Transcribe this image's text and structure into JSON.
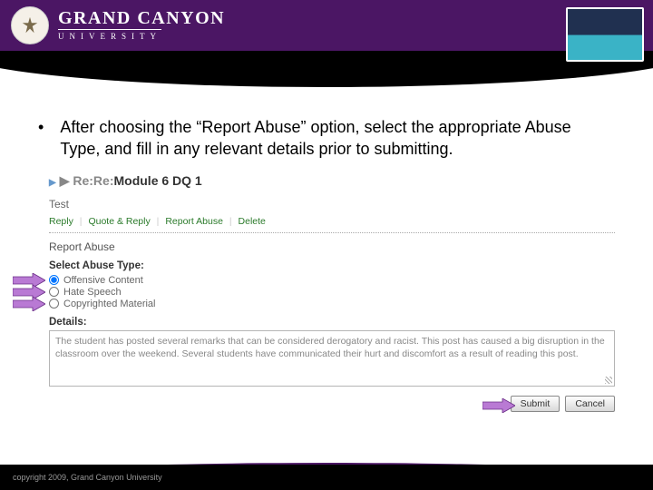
{
  "header": {
    "university_name_top": "GRAND CANYON",
    "university_name_bot": "UNIVERSITY"
  },
  "bullet_text": "After choosing the “Report Abuse” option, select the appropriate Abuse Type, and fill in any relevant details prior to submitting.",
  "screenshot": {
    "thread_prefix": "▶ Re:Re:",
    "thread_title": "Module 6 DQ 1",
    "test_label": "Test",
    "actions": {
      "reply": "Reply",
      "quote": "Quote & Reply",
      "report": "Report Abuse",
      "delete": "Delete"
    },
    "report_abuse_heading": "Report Abuse",
    "select_abuse_type": "Select Abuse Type:",
    "radios": {
      "offensive": "Offensive Content",
      "hate": "Hate Speech",
      "copyright": "Copyrighted Material"
    },
    "details_label": "Details:",
    "details_text": "The student has posted several remarks that can be considered derogatory and racist. This post has caused a big disruption in the classroom over the weekend. Several students have communicated their hurt and discomfort as a result of reading this post.",
    "submit": "Submit",
    "cancel": "Cancel"
  },
  "footer": "copyright 2009, Grand Canyon University"
}
